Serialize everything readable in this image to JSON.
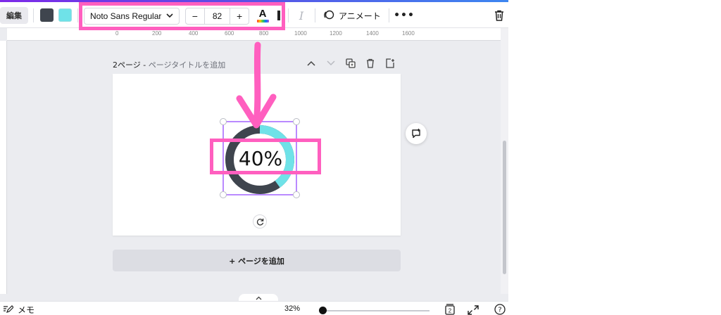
{
  "toolbar": {
    "edit_label": "編集",
    "font_name": "Noto Sans Regular",
    "font_size": "82",
    "minus_label": "−",
    "plus_label": "+",
    "text_color_letter": "A",
    "italic_label": "I",
    "animate_label": "アニメート",
    "more_label": "•••"
  },
  "colors": {
    "dark_swatch": "#3f454e",
    "cyan_swatch": "#6fe2e8",
    "highlight": "#ff5fbf",
    "selection": "#8b3dff"
  },
  "ruler": {
    "ticks": [
      "0",
      "200",
      "400",
      "600",
      "800",
      "1000",
      "1200",
      "1400",
      "1600"
    ]
  },
  "page": {
    "number_label": "2ページ - ",
    "title_placeholder": "ページタイトルを追加"
  },
  "element": {
    "percent_text": "40%",
    "progress_value": 0.4,
    "ring_dark": "#3f454e",
    "ring_cyan": "#6fe2e8"
  },
  "add_page_label": "+ ページを追加",
  "footer": {
    "notes_label": "メモ",
    "zoom_label": "32%",
    "page_count": "2",
    "help_label": "?"
  },
  "icons": [
    "edit-pen-icon",
    "chevron-down-icon",
    "animate-icon",
    "trash-icon",
    "chevron-up-icon",
    "duplicate-icon",
    "add-page-icon",
    "rotate-icon",
    "comment-add-icon",
    "pages-icon",
    "expand-icon",
    "help-icon",
    "notes-icon"
  ]
}
